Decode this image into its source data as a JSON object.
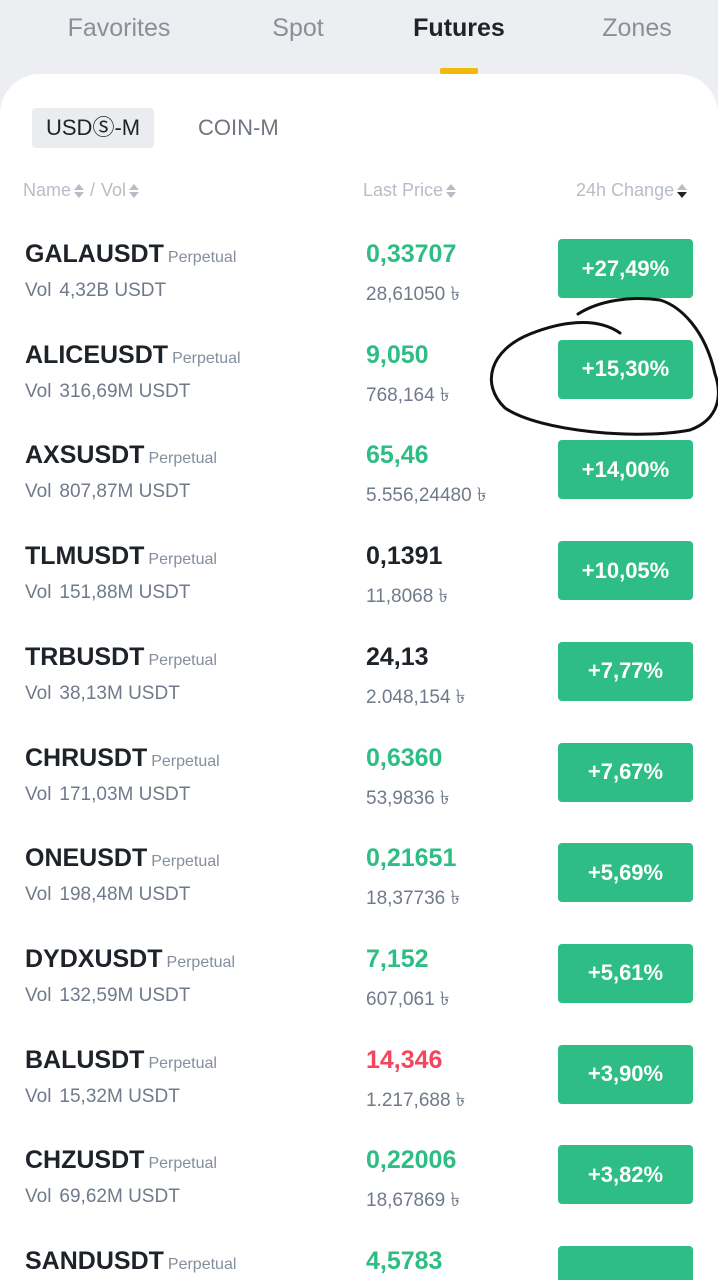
{
  "top_tabs": [
    {
      "label": "Favorites",
      "active": false
    },
    {
      "label": "Spot",
      "active": false
    },
    {
      "label": "Futures",
      "active": true
    },
    {
      "label": "Zones",
      "active": false
    }
  ],
  "sub_tabs": [
    {
      "label": "USDⓈ-M",
      "active": true
    },
    {
      "label": "COIN-M",
      "active": false
    }
  ],
  "columns": {
    "name": "Name",
    "slash": "/",
    "vol": "Vol",
    "last_price": "Last Price",
    "change": "24h Change"
  },
  "colors": {
    "green": "#2ebd85",
    "red": "#f6465d",
    "neutral": "#1e2329",
    "accent": "#f0b90b"
  },
  "rows": [
    {
      "symbol": "GALAUSDT",
      "type": "Perpetual",
      "vol_label": "Vol",
      "vol": "4,32B USDT",
      "price": "0,33707",
      "price_dir": "up",
      "fiat": "28,61050 ৳",
      "change": "+27,49%"
    },
    {
      "symbol": "ALICEUSDT",
      "type": "Perpetual",
      "vol_label": "Vol",
      "vol": "316,69M USDT",
      "price": "9,050",
      "price_dir": "up",
      "fiat": "768,164 ৳",
      "change": "+15,30%"
    },
    {
      "symbol": "AXSUSDT",
      "type": "Perpetual",
      "vol_label": "Vol",
      "vol": "807,87M USDT",
      "price": "65,46",
      "price_dir": "up",
      "fiat": "5.556,24480 ৳",
      "change": "+14,00%"
    },
    {
      "symbol": "TLMUSDT",
      "type": "Perpetual",
      "vol_label": "Vol",
      "vol": "151,88M USDT",
      "price": "0,1391",
      "price_dir": "neutral",
      "fiat": "11,8068 ৳",
      "change": "+10,05%"
    },
    {
      "symbol": "TRBUSDT",
      "type": "Perpetual",
      "vol_label": "Vol",
      "vol": "38,13M USDT",
      "price": "24,13",
      "price_dir": "neutral",
      "fiat": "2.048,154 ৳",
      "change": "+7,77%"
    },
    {
      "symbol": "CHRUSDT",
      "type": "Perpetual",
      "vol_label": "Vol",
      "vol": "171,03M USDT",
      "price": "0,6360",
      "price_dir": "up",
      "fiat": "53,9836 ৳",
      "change": "+7,67%"
    },
    {
      "symbol": "ONEUSDT",
      "type": "Perpetual",
      "vol_label": "Vol",
      "vol": "198,48M USDT",
      "price": "0,21651",
      "price_dir": "up",
      "fiat": "18,37736 ৳",
      "change": "+5,69%"
    },
    {
      "symbol": "DYDXUSDT",
      "type": "Perpetual",
      "vol_label": "Vol",
      "vol": "132,59M USDT",
      "price": "7,152",
      "price_dir": "up",
      "fiat": "607,061 ৳",
      "change": "+5,61%"
    },
    {
      "symbol": "BALUSDT",
      "type": "Perpetual",
      "vol_label": "Vol",
      "vol": "15,32M USDT",
      "price": "14,346",
      "price_dir": "down",
      "fiat": "1.217,688 ৳",
      "change": "+3,90%"
    },
    {
      "symbol": "CHZUSDT",
      "type": "Perpetual",
      "vol_label": "Vol",
      "vol": "69,62M USDT",
      "price": "0,22006",
      "price_dir": "up",
      "fiat": "18,67869 ৳",
      "change": "+3,82%"
    },
    {
      "symbol": "SANDUSDT",
      "type": "Perpetual",
      "vol_label": "Vol",
      "vol": "",
      "price": "4,5783",
      "price_dir": "up",
      "fiat": "",
      "change": ""
    }
  ]
}
